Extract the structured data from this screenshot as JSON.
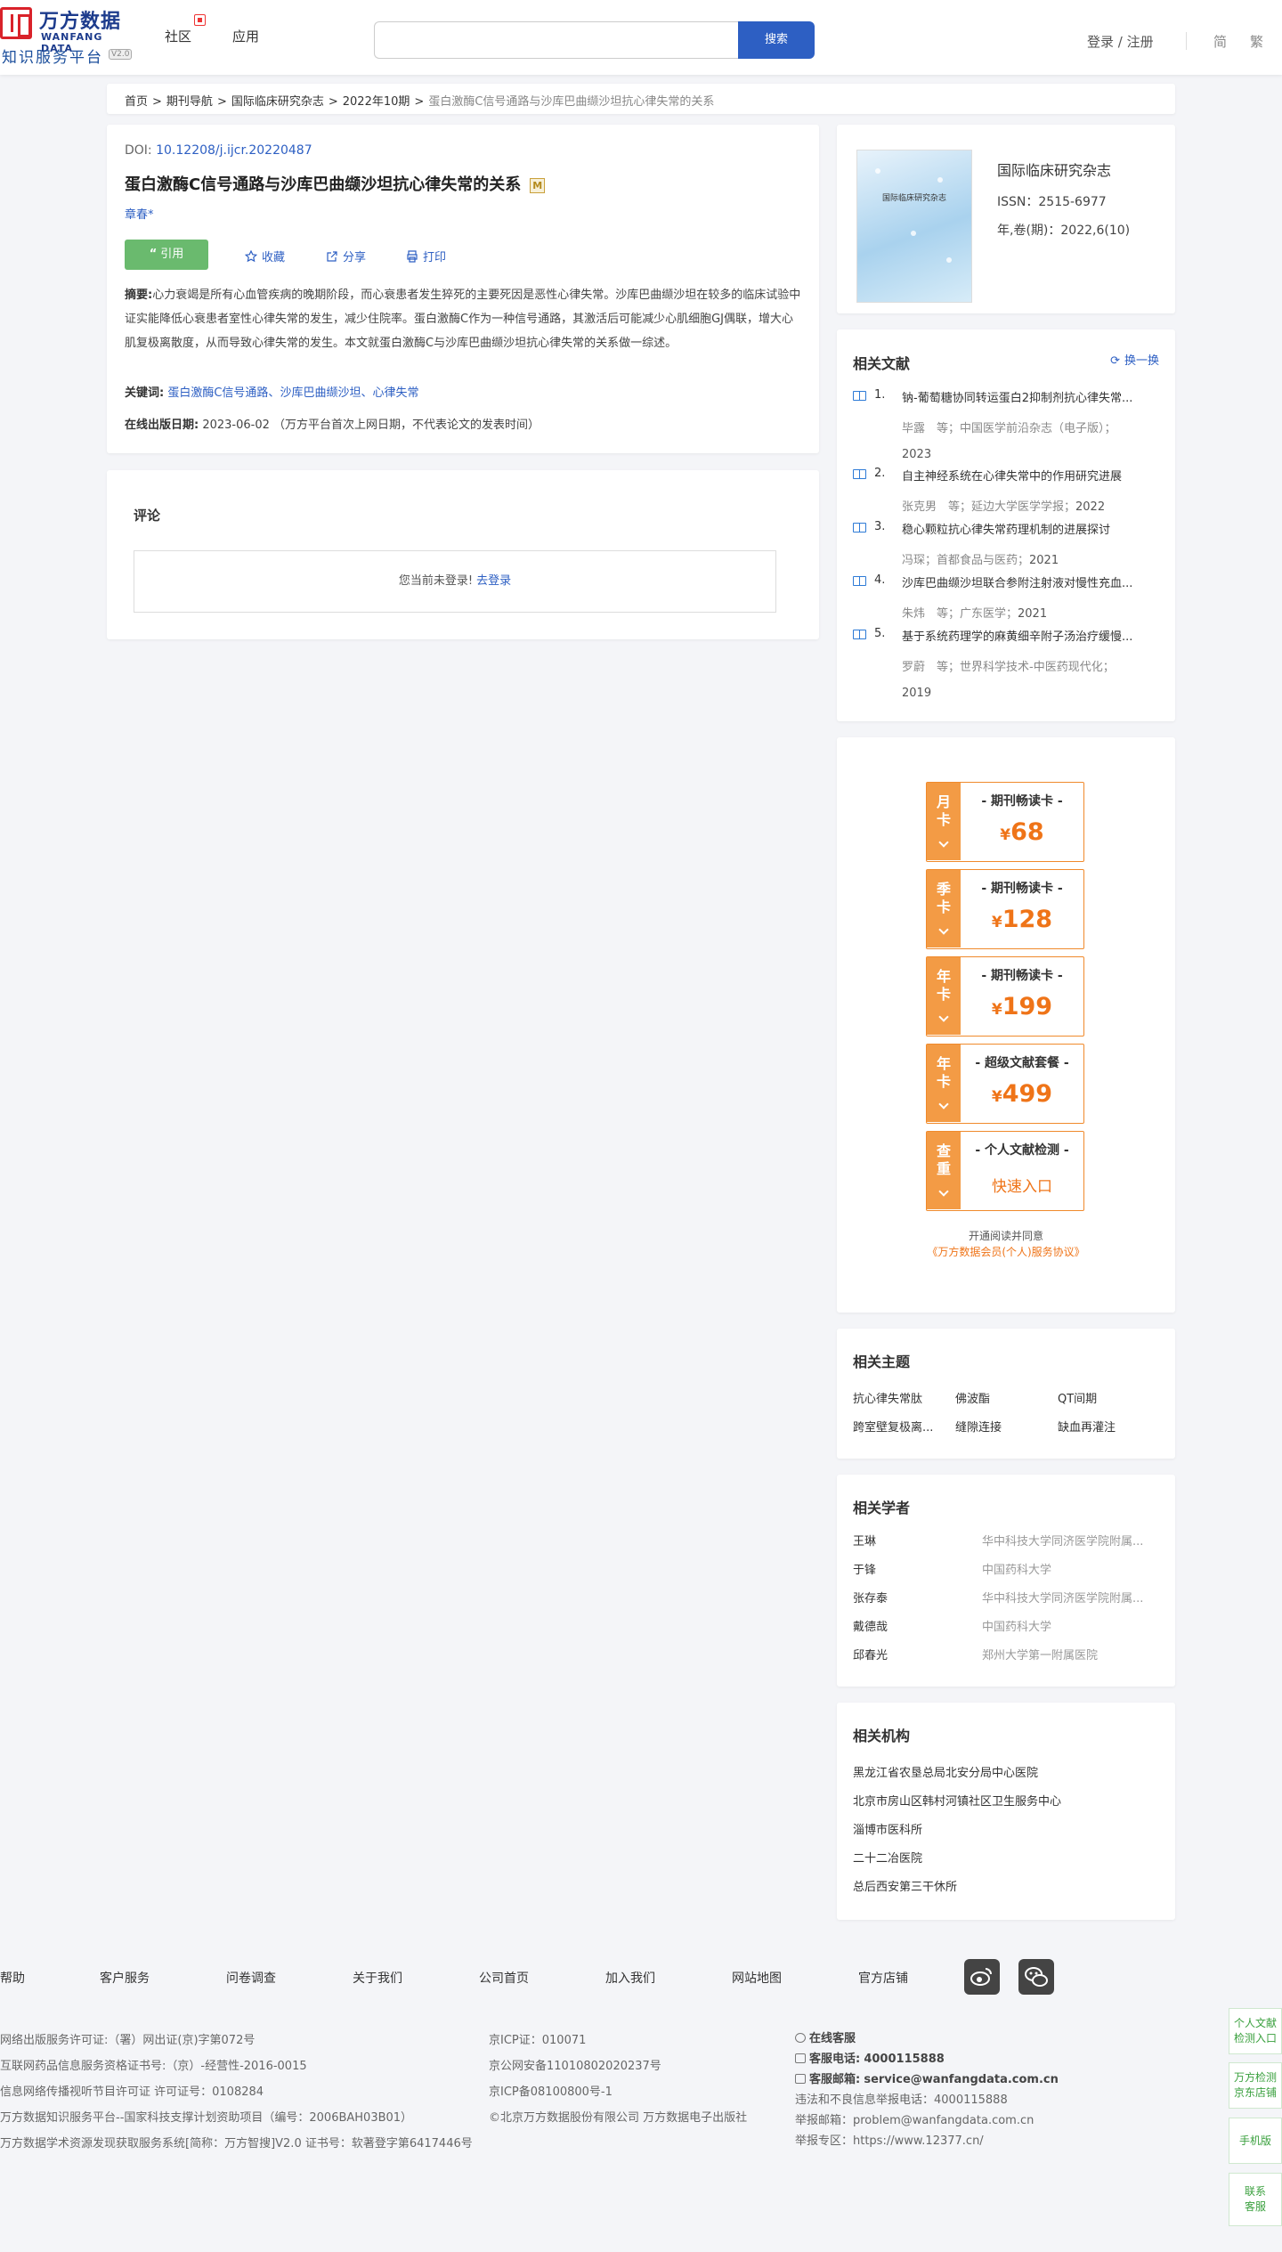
{
  "header": {
    "logo_cn": "万方数据",
    "logo_en": "WANFANG DATA",
    "logo_sub": "知识服务平台",
    "logo_ver": "V2.0",
    "nav": [
      "社区",
      "应用"
    ],
    "search_button": "搜索",
    "login": "登录 / 注册",
    "lang_simple": "简",
    "lang_trad": "繁"
  },
  "breadcrumb": [
    "首页",
    "期刊导航",
    "国际临床研究杂志",
    "2022年10期",
    "蛋白激酶C信号通路与沙库巴曲缬沙坦抗心律失常的关系"
  ],
  "article": {
    "doi_label": "DOI: ",
    "doi": "10.12208/j.ijcr.20220487",
    "title": "蛋白激酶C信号通路与沙库巴曲缬沙坦抗心律失常的关系",
    "title_badge": "M",
    "author": "章春*",
    "cite": "引用",
    "actions": [
      "收藏",
      "分享",
      "打印"
    ],
    "abstract_label": "摘要:",
    "abstract": "心力衰竭是所有心血管疾病的晚期阶段，而心衰患者发生猝死的主要死因是恶性心律失常。沙库巴曲缬沙坦在较多的临床试验中证实能降低心衰患者室性心律失常的发生，减少住院率。蛋白激酶C作为一种信号通路，其激活后可能减少心肌细胞GJ偶联，增大心肌复极离散度，从而导致心律失常的发生。本文就蛋白激酶C与沙库巴曲缬沙坦抗心律失常的关系做一综述。",
    "keywords_label": "关键词:",
    "keywords": [
      "蛋白激酶C信号通路",
      "沙库巴曲缬沙坦",
      "心律失常"
    ],
    "keyword_sep": "、",
    "pub_label": "在线出版日期:",
    "pub_date": "2023-06-02",
    "pub_note": "（万方平台首次上网日期，不代表论文的发表时间）"
  },
  "comment": {
    "title": "评论",
    "not_logged": "您当前未登录!",
    "login_link": "去登录"
  },
  "journal": {
    "cover_text": "国际临床研究杂志",
    "name": "国际临床研究杂志",
    "issn": "ISSN：2515-6977",
    "issue": "年,卷(期)：2022,6(10)"
  },
  "related": {
    "title": "相关文献",
    "refresh": "换一换",
    "items": [
      {
        "num": "1.",
        "title": "钠-葡萄糖协同转运蛋白2抑制剂抗心律失常...",
        "meta": "毕露　等；中国医学前沿杂志（电子版）；",
        "year": "2023"
      },
      {
        "num": "2.",
        "title": "自主神经系统在心律失常中的作用研究进展",
        "meta": "张克男　等；延边大学医学学报；",
        "year": "2022"
      },
      {
        "num": "3.",
        "title": "稳心颗粒抗心律失常药理机制的进展探讨",
        "meta": "冯琛；首都食品与医药；",
        "year": "2021"
      },
      {
        "num": "4.",
        "title": "沙库巴曲缬沙坦联合参附注射液对慢性充血...",
        "meta": "朱炜　等；广东医学；",
        "year": "2021"
      },
      {
        "num": "5.",
        "title": "基于系统药理学的麻黄细辛附子汤治疗缓慢...",
        "meta": "罗蔚　等；世界科学技术-中医药现代化；",
        "year": "2019"
      }
    ]
  },
  "vip": {
    "cards": [
      {
        "side": "月卡",
        "name": "- 期刊畅读卡 -",
        "currency": "¥",
        "price": "68"
      },
      {
        "side": "季卡",
        "name": "- 期刊畅读卡 -",
        "currency": "¥",
        "price": "128"
      },
      {
        "side": "年卡",
        "name": "- 期刊畅读卡 -",
        "currency": "¥",
        "price": "199"
      },
      {
        "side": "年卡",
        "name": "- 超级文献套餐 -",
        "currency": "¥",
        "price": "499"
      },
      {
        "side": "查重",
        "name": "- 个人文献检测 -",
        "link": "快速入口"
      }
    ],
    "agree": "开通阅读并同意",
    "agree_link": "《万方数据会员(个人)服务协议》"
  },
  "topics": {
    "title": "相关主题",
    "items": [
      "抗心律失常肽",
      "佛波酯",
      "QT间期",
      "跨室壁复极离...",
      "缝隙连接",
      "缺血再灌注"
    ]
  },
  "scholars": {
    "title": "相关学者",
    "items": [
      {
        "name": "王琳",
        "unit": "华中科技大学同济医学院附属..."
      },
      {
        "name": "于锋",
        "unit": "中国药科大学"
      },
      {
        "name": "张存泰",
        "unit": "华中科技大学同济医学院附属..."
      },
      {
        "name": "戴德哉",
        "unit": "中国药科大学"
      },
      {
        "name": "邱春光",
        "unit": "郑州大学第一附属医院"
      }
    ]
  },
  "institutions": {
    "title": "相关机构",
    "items": [
      "黑龙江省农垦总局北安分局中心医院",
      "北京市房山区韩村河镇社区卫生服务中心",
      "淄博市医科所",
      "二十二冶医院",
      "总后西安第三干休所"
    ]
  },
  "footer": {
    "nav": [
      "帮助",
      "客户服务",
      "问卷调查",
      "关于我们",
      "公司首页",
      "加入我们",
      "网站地图",
      "官方店铺"
    ],
    "col1": [
      "网络出版服务许可证:（署）网出证(京)字第072号",
      "互联网药品信息服务资格证书号:（京）-经营性-2016-0015",
      "信息网络传播视听节目许可证 许可证号：0108284",
      "万方数据知识服务平台--国家科技支撑计划资助项目（编号：2006BAH03B01）",
      "万方数据学术资源发现获取服务系统[简称：万方智搜]V2.0 证书号：软著登字第6417446号"
    ],
    "col2": [
      "京ICP证：010071",
      "京公网安备11010802020237号",
      "京ICP备08100800号-1",
      "©北京万方数据股份有限公司 万方数据电子出版社"
    ],
    "online_service": "在线客服",
    "phone_label": "客服电话:",
    "phone": "4000115888",
    "email_label": "客服邮箱:",
    "email": "service@wanfangdata.com.cn",
    "report_phone": "违法和不良信息举报电话：4000115888",
    "report_email": "举报邮箱：problem@wanfangdata.com.cn",
    "report_zone": "举报专区：https://www.12377.cn/"
  },
  "float_tabs": [
    "个人文献检测入口",
    "万方检测京东店铺",
    "手机版",
    "联系客服"
  ],
  "colors": {
    "brand_blue": "#2d5fc3",
    "cite_green": "#6aba6e",
    "vip_orange": "#ef7418"
  }
}
